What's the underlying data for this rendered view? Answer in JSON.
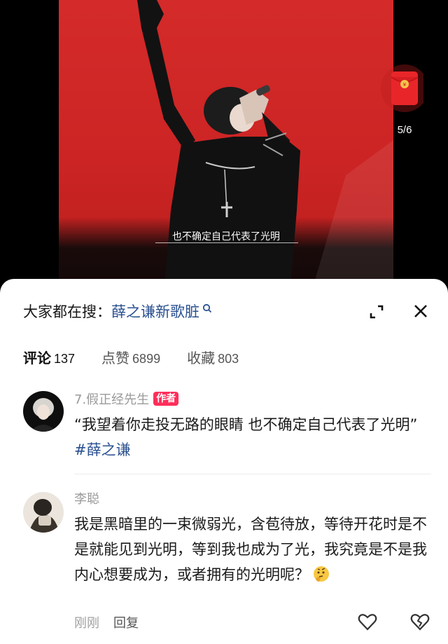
{
  "video": {
    "subtitle": "也不确定自己代表了光明",
    "red_packet": {
      "icon": "red-envelope-icon",
      "progress_text": "5/6",
      "color": "#e02424"
    }
  },
  "sheet": {
    "search": {
      "prefix": "大家都在搜：",
      "term": "薛之谦新歌脏",
      "icon": "search-icon"
    },
    "controls": {
      "expand_icon": "expand-icon",
      "close_icon": "close-icon"
    },
    "tabs": [
      {
        "label": "评论",
        "count": "137",
        "active": true
      },
      {
        "label": "点赞",
        "count": "6899",
        "active": false
      },
      {
        "label": "收藏",
        "count": "803",
        "active": false
      }
    ],
    "comments": [
      {
        "user": "7.假正经先生",
        "badge": "作者",
        "text": "“我望着你走投无路的眼睛 也不确定自己代表了光明”",
        "hashtag": "#薛之谦"
      },
      {
        "user": "李聪",
        "text": "我是黑暗里的一束微弱光，含苞待放，等待开花时是不是就能见到光明，等到我也成为了光，我究竟是不是我内心想要成为，或者拥有的光明呢？",
        "emoji": "thinking-face-icon",
        "time": "刚刚",
        "reply_label": "回复"
      }
    ]
  },
  "colors": {
    "accent_link": "#2a5090",
    "badge": "#ff2e5a",
    "video_bg": "#cc2424"
  }
}
